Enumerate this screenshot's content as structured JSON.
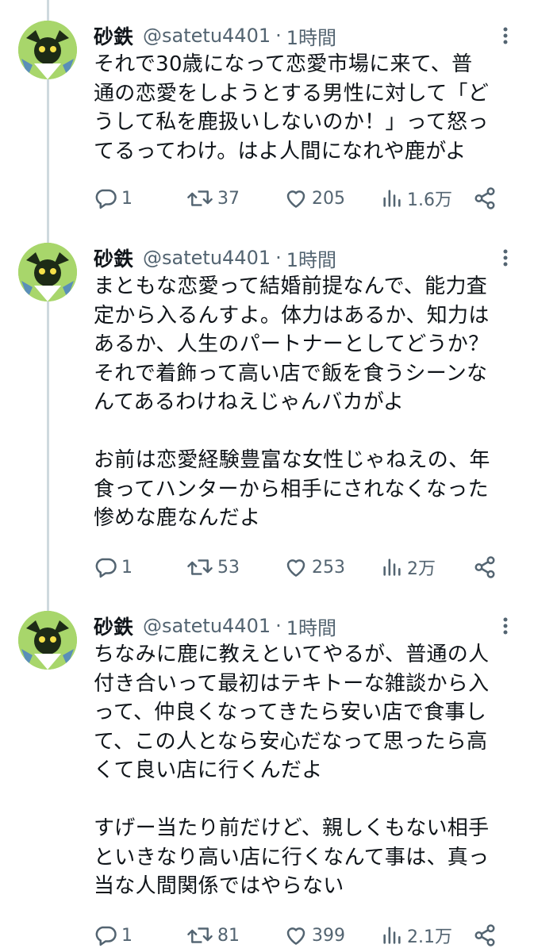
{
  "tweets": [
    {
      "author": {
        "name": "砂鉄",
        "handle": "@satetu4401"
      },
      "separator": "·",
      "time": "1時間",
      "text": "それで30歳になって恋愛市場に来て、普\n通の恋愛をしようとする男性に対して「ど\nうして私を鹿扱いしないのか！」って怒っ\nてるってわけ。はよ人間になれや鹿がよ",
      "stats": {
        "replies": "1",
        "reposts": "37",
        "likes": "205",
        "views": "1.6万"
      }
    },
    {
      "author": {
        "name": "砂鉄",
        "handle": "@satetu4401"
      },
      "separator": "·",
      "time": "1時間",
      "text": "まともな恋愛って結婚前提なんで、能力査\n定から入るんすよ。体力はあるか、知力は\nあるか、人生のパートナーとしてどうか？\nそれで着飾って高い店で飯を食うシーンな\nんてあるわけねえじゃんバカがよ\n\nお前は恋愛経験豊富な女性じゃねえの、年\n食ってハンターから相手にされなくなった\n惨めな鹿なんだよ",
      "stats": {
        "replies": "1",
        "reposts": "53",
        "likes": "253",
        "views": "2万"
      }
    },
    {
      "author": {
        "name": "砂鉄",
        "handle": "@satetu4401"
      },
      "separator": "·",
      "time": "1時間",
      "text": "ちなみに鹿に教えといてやるが、普通の人\n付き合いって最初はテキトーな雑談から入\nって、仲良くなってきたら安い店で食事し\nて、この人となら安心だなって思ったら高\nくて良い店に行くんだよ\n\nすげー当たり前だけど、親しくもない相手\nといきなり高い店に行くなんて事は、真っ\n当な人間関係ではやらない",
      "stats": {
        "replies": "1",
        "reposts": "81",
        "likes": "399",
        "views": "2.1万"
      }
    }
  ],
  "colors": {
    "text": "#0f1419",
    "secondary": "#536471",
    "thread_line": "#cfd9de",
    "avatar_bg": "#a8d66b"
  },
  "icons": {
    "reply": "reply-icon",
    "repost": "repost-icon",
    "like": "heart-icon",
    "views": "views-chart-icon",
    "share": "share-icon",
    "more": "more-options-icon"
  }
}
